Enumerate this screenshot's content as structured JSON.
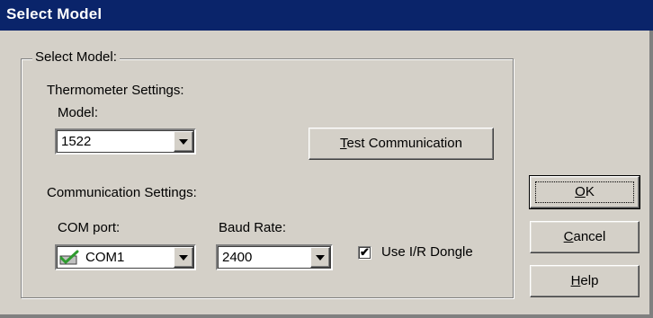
{
  "window": {
    "title": "Select Model"
  },
  "group": {
    "legend": "Select Model:"
  },
  "thermometer": {
    "heading": "Thermometer Settings:",
    "model_label": "Model:",
    "model_value": "1522"
  },
  "test_button": {
    "mnemonic": "T",
    "rest": "est Communication"
  },
  "communication": {
    "heading": "Communication Settings:",
    "com_label": "COM port:",
    "com_value": "COM1",
    "com_icon": "green-check-port-icon",
    "baud_label": "Baud Rate:",
    "baud_value": "2400"
  },
  "dongle": {
    "label": "Use I/R Dongle",
    "checked": true
  },
  "buttons": {
    "ok": {
      "mnemonic": "O",
      "rest": "K"
    },
    "cancel": {
      "mnemonic": "C",
      "rest": "ancel"
    },
    "help": {
      "mnemonic": "H",
      "rest": "elp"
    }
  },
  "colors": {
    "titlebar": "#0a246a",
    "face": "#d4d0c8",
    "check_icon": "#2e9b2e"
  }
}
